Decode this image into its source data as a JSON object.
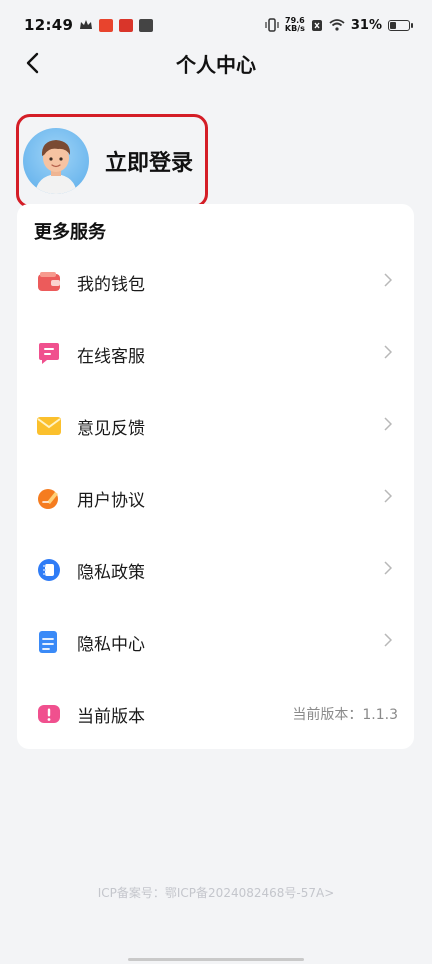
{
  "status_bar": {
    "time": "12:49",
    "net_speed_value": "79.6",
    "net_speed_unit": "KB/s",
    "battery": "31%"
  },
  "header": {
    "title": "个人中心"
  },
  "profile": {
    "login_label": "立即登录"
  },
  "services": {
    "title": "更多服务",
    "items": [
      {
        "label": "我的钱包",
        "icon": "wallet-icon"
      },
      {
        "label": "在线客服",
        "icon": "chat-icon"
      },
      {
        "label": "意见反馈",
        "icon": "mail-icon"
      },
      {
        "label": "用户协议",
        "icon": "edit-icon"
      },
      {
        "label": "隐私政策",
        "icon": "notebook-icon"
      },
      {
        "label": "隐私中心",
        "icon": "document-icon"
      },
      {
        "label": "当前版本",
        "icon": "alert-icon",
        "value": "当前版本：1.1.3"
      }
    ]
  },
  "footer": {
    "icp": "ICP备案号：鄂ICP备2024082468号-57A>"
  },
  "colors": {
    "highlight_border": "#d41d26",
    "background": "#f3f4f6",
    "card": "#ffffff"
  }
}
